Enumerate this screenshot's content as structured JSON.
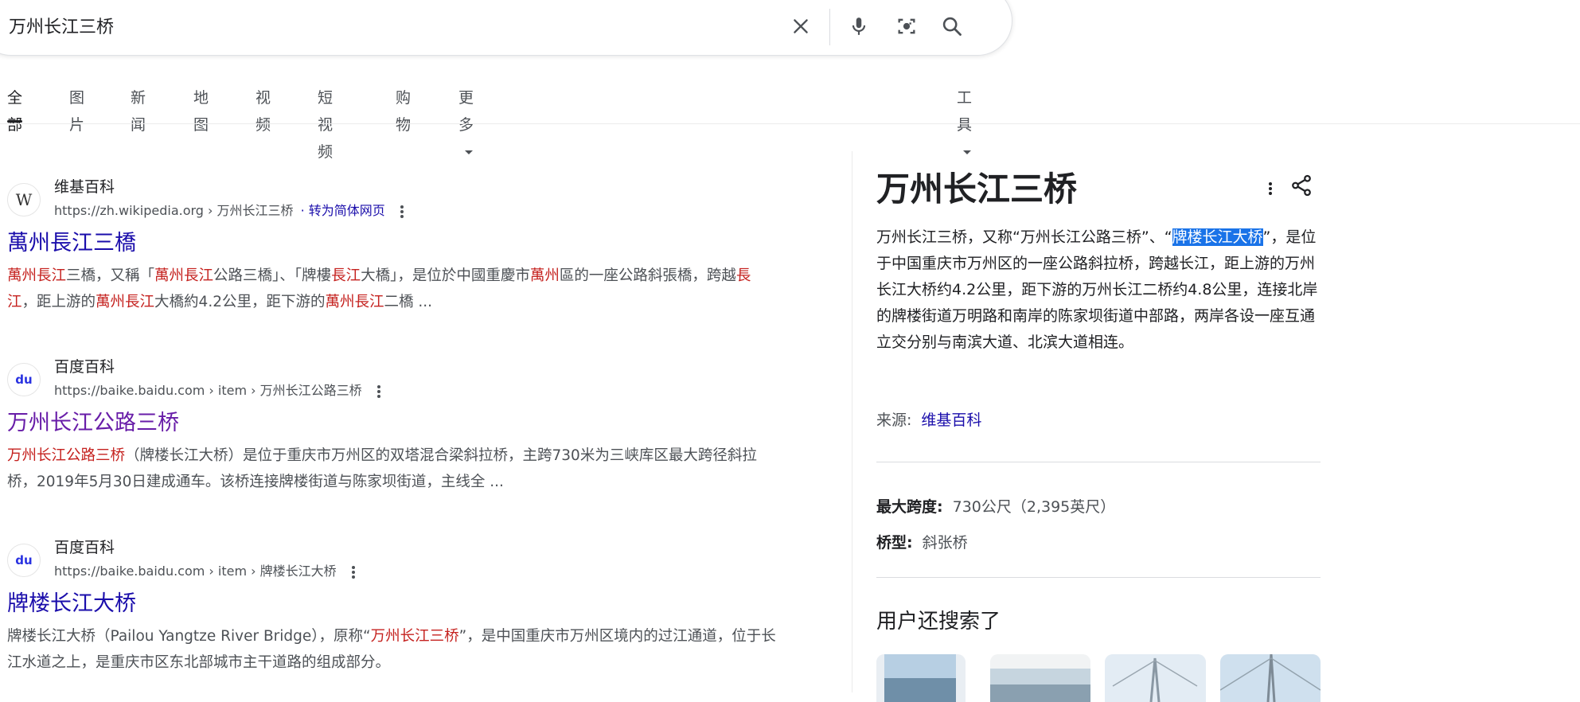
{
  "search": {
    "query": "万州长江三桥",
    "icons": [
      "close-icon",
      "microphone-icon",
      "camera-icon",
      "search-icon"
    ]
  },
  "tabs": [
    {
      "label": "全部",
      "active": true
    },
    {
      "label": "图片"
    },
    {
      "label": "新闻"
    },
    {
      "label": "地图"
    },
    {
      "label": "视频"
    },
    {
      "label": "短视频"
    },
    {
      "label": "购物"
    },
    {
      "label": "更多"
    }
  ],
  "tools_label": "工具",
  "results": [
    {
      "source": "维基百科",
      "favicon_letter": "W",
      "url": "https://zh.wikipedia.org › 万州长江三桥",
      "translate_link": "· 转为简体网页",
      "title": "萬州長江三橋",
      "snippet_parts": [
        {
          "t": "萬州長江",
          "hl": true
        },
        {
          "t": "三橋，又稱「"
        },
        {
          "t": "萬州長江",
          "hl": true
        },
        {
          "t": "公路三橋」、「牌樓"
        },
        {
          "t": "長江",
          "hl": true
        },
        {
          "t": "大橋」，是位於中國重慶市"
        },
        {
          "t": "萬州",
          "hl": true
        },
        {
          "t": "區的一座公路斜張橋，跨越"
        },
        {
          "t": "長江",
          "hl": true
        },
        {
          "t": "，距上游的"
        },
        {
          "t": "萬州長江",
          "hl": true
        },
        {
          "t": "大橋約4.2公里，距下游的"
        },
        {
          "t": "萬州長江",
          "hl": true
        },
        {
          "t": "二橋 ..."
        }
      ]
    },
    {
      "source": "百度百科",
      "favicon_letter": "du",
      "url": "https://baike.baidu.com › item › 万州长江公路三桥",
      "title": "万州长江公路三桥",
      "snippet_parts": [
        {
          "t": "万州长江公路三桥",
          "hl": true
        },
        {
          "t": "（牌楼长江大桥）是位于重庆市万州区的双塔混合梁斜拉桥，主跨730米为三峡库区最大跨径斜拉桥，2019年5月30日建成通车。该桥连接牌楼街道与陈家坝街道，主线全 ..."
        }
      ]
    },
    {
      "source": "百度百科",
      "favicon_letter": "du",
      "url": "https://baike.baidu.com › item › 牌楼长江大桥",
      "title": "牌楼长江大桥",
      "snippet_parts": [
        {
          "t": "牌楼长江大桥（Pailou Yangtze River Bridge），原称“"
        },
        {
          "t": "万州长江三桥",
          "hl": true
        },
        {
          "t": "”，是中国重庆市万州区境内的过江通道，位于长江水道之上，是重庆市区东北部城市主干道路的组成部分。"
        }
      ]
    }
  ],
  "knowledge_panel": {
    "title": "万州长江三桥",
    "desc_before": "万州长江三桥，又称“万州长江公路三桥”、“",
    "desc_selected": "牌楼长江大桥",
    "desc_after": "”，是位于中国重庆市万州区的一座公路斜拉桥，跨越长江，距上游的万州长江大桥约4.2公里，距下游的万州长江二桥约4.8公里，连接北岸的牌楼街道万明路和南岸的陈家坝街道中部路，两岸各设一座互通立交分别与南滨大道、北滨大道相连。",
    "source_label": "来源:",
    "source_link": "维基百科",
    "facts": [
      {
        "label": "最大跨度:",
        "value": "730公尺（2,395英尺）"
      },
      {
        "label": "桥型:",
        "value": "斜张桥"
      }
    ],
    "people_also_search": "用户还搜索了"
  },
  "colors": {
    "link": "#1a0dab",
    "visited": "#681da8",
    "highlight": "#c5221f",
    "selection": "#1a73e8"
  }
}
